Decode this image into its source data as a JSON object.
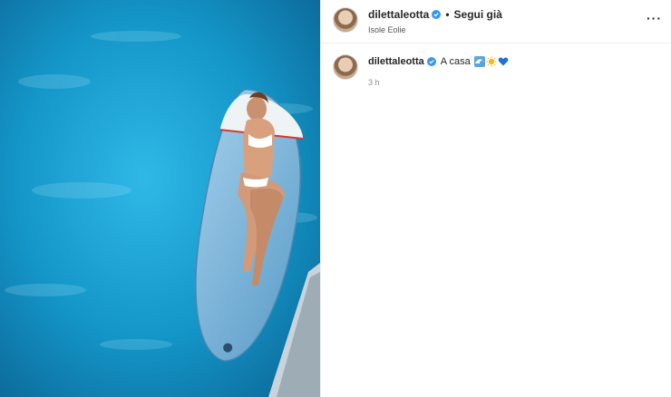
{
  "header": {
    "username": "dilettaleotta",
    "separator": "•",
    "follow_label": "Segui già",
    "location": "Isole Eolie",
    "more_label": "···"
  },
  "caption": {
    "username": "dilettaleotta",
    "text": "A casa",
    "emojis": [
      "wave-icon",
      "sun-icon",
      "blue-heart-icon"
    ],
    "timestamp": "3 h"
  },
  "colors": {
    "verified": "#3897f0",
    "water": "#1aa3d6",
    "board": "#7ab6dc"
  }
}
